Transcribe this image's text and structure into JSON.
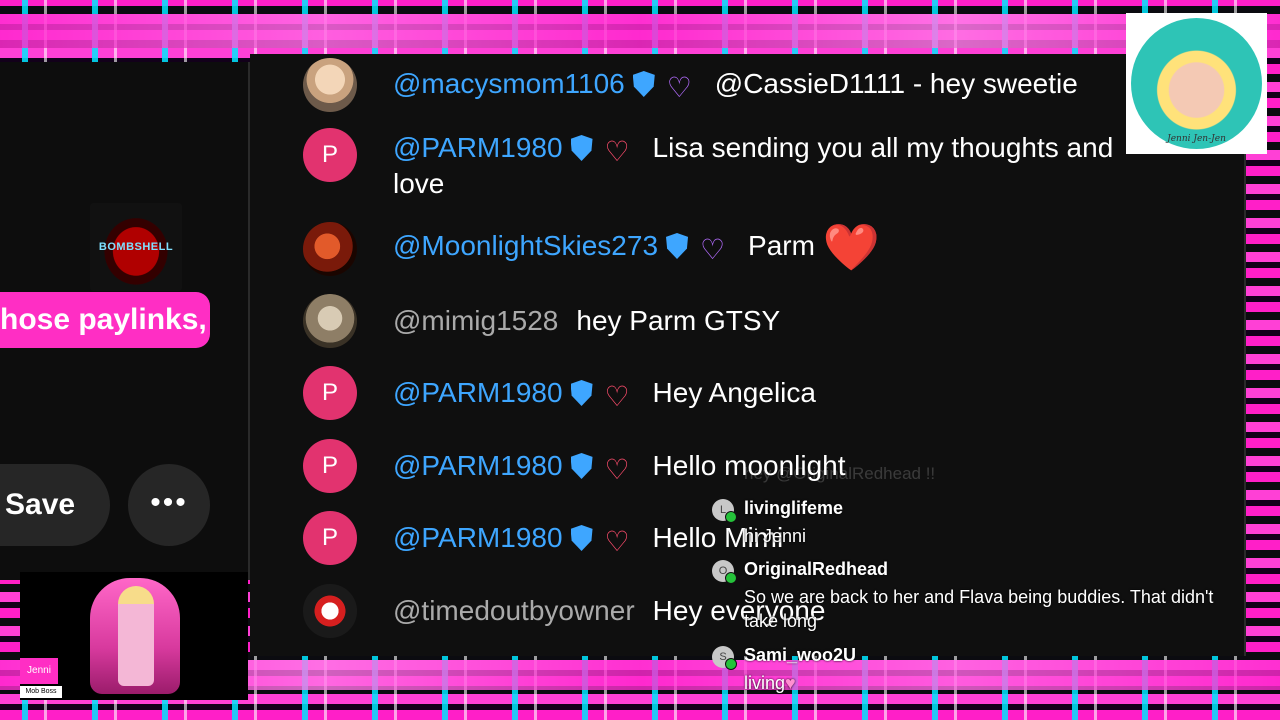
{
  "left_panel": {
    "thumb_text": "BOMBSHELL",
    "bubble_text": "hose paylinks,",
    "save_label": "Save",
    "more_label": "•••"
  },
  "avatar_card": {
    "name": "Jenni",
    "role": "Mob Boss"
  },
  "logo": {
    "text": "Jenni Jen-Jen"
  },
  "chat": {
    "messages": [
      {
        "author": "@macysmom1106",
        "avatar": "",
        "message": "@CassieD1111 - hey sweetie",
        "author_color": "#3ea6ff",
        "heart": "purple"
      },
      {
        "author": "@PARM1980",
        "avatar": "P",
        "message": "Lisa sending you all my thoughts and love",
        "author_color": "#3ea6ff",
        "heart": "red"
      },
      {
        "author": "@MoonlightSkies273",
        "avatar": "",
        "message": "Parm",
        "author_color": "#3ea6ff",
        "heart": "purple",
        "emoji": "❤️"
      },
      {
        "author": "@mimig1528",
        "avatar": "",
        "message": "hey Parm GTSY",
        "author_color": "#aaaaaa"
      },
      {
        "author": "@PARM1980",
        "avatar": "P",
        "message": "Hey Angelica",
        "author_color": "#3ea6ff",
        "heart": "red"
      },
      {
        "author": "@PARM1980",
        "avatar": "P",
        "message": "Hello moonlight",
        "author_color": "#3ea6ff",
        "heart": "red"
      },
      {
        "author": "@PARM1980",
        "avatar": "P",
        "message": "Hello Mimi",
        "author_color": "#3ea6ff",
        "heart": "red"
      },
      {
        "author": "@timedoutbyowner",
        "avatar": "",
        "message": "Hey everyone",
        "author_color": "#aaaaaa"
      }
    ]
  },
  "overlay": {
    "faded_text": "hey @OriginalRedhead !!",
    "entries": [
      {
        "badge": "L",
        "user": "livinglifeme",
        "message": "hi Jenni"
      },
      {
        "badge": "O",
        "user": "OriginalRedhead",
        "message": "So we are back to her and Flava being buddies. That didn't take long"
      },
      {
        "badge": "S",
        "user": "Sami_woo2U",
        "message": "living"
      }
    ]
  },
  "colors": {
    "accent_pink": "#ff2ec4",
    "author_blue": "#3ea6ff",
    "avatar_pink": "#e2336f"
  }
}
